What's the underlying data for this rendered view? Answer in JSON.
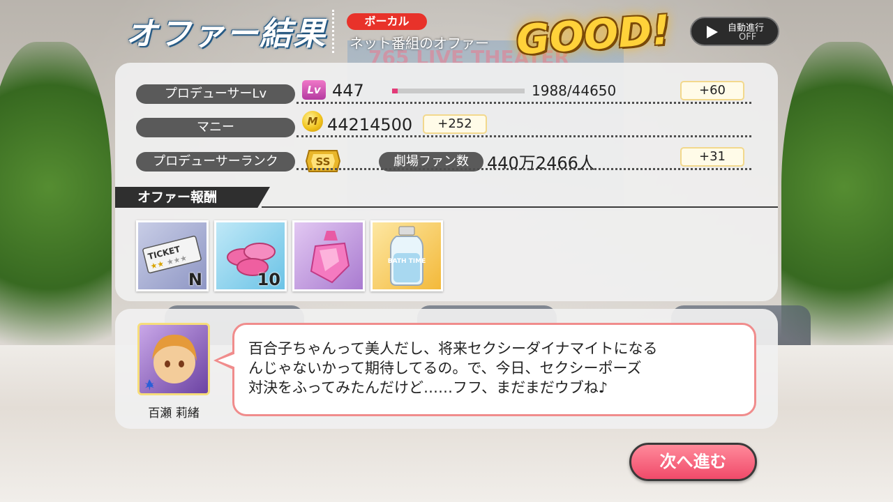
{
  "header": {
    "title": "オファー結果",
    "category_badge": "ボーカル",
    "offer_name": "ネット番組のオファー",
    "result": "GOOD!",
    "screen_text": "765 LIVE THEATER"
  },
  "auto_advance": {
    "label": "自動進行",
    "state": "OFF"
  },
  "stats": {
    "producer_lv": {
      "label": "プロデューサーLv",
      "icon_text": "Lv",
      "value": "447",
      "progress_text": "1988/44650",
      "progress_fraction": 0.0445,
      "gain": "+60"
    },
    "money": {
      "label": "マニー",
      "icon_text": "M",
      "value": "44214500",
      "gain": "+252"
    },
    "producer_rank": {
      "label": "プロデューサーランク",
      "rank_icon_text": "SS"
    },
    "theater_fans": {
      "label": "劇場ファン数",
      "value": "440万2466人",
      "gain": "+31"
    }
  },
  "rewards": {
    "header": "オファー報酬",
    "items": [
      {
        "name": "ticket",
        "ticket_text": "TICKET",
        "badge": "N"
      },
      {
        "name": "candy-coins",
        "quantity": "10"
      },
      {
        "name": "perfume-bottle"
      },
      {
        "name": "bath-salt",
        "label_text": "BATH TIME"
      }
    ]
  },
  "dialogue": {
    "character_name": "百瀬 莉緒",
    "text_lines": [
      "百合子ちゃんって美人だし、将来セクシーダイナマイトになる",
      "んじゃないかって期待してるの。で、今日、セクシーポーズ",
      "対決をふってみたんだけど……フフ、まだまだウブね♪"
    ]
  },
  "next_button": {
    "label": "次へ進む"
  },
  "colors": {
    "accent_pink": "#f04a6a",
    "badge_red": "#e8322a",
    "good_yellow": "#ffd23a"
  }
}
